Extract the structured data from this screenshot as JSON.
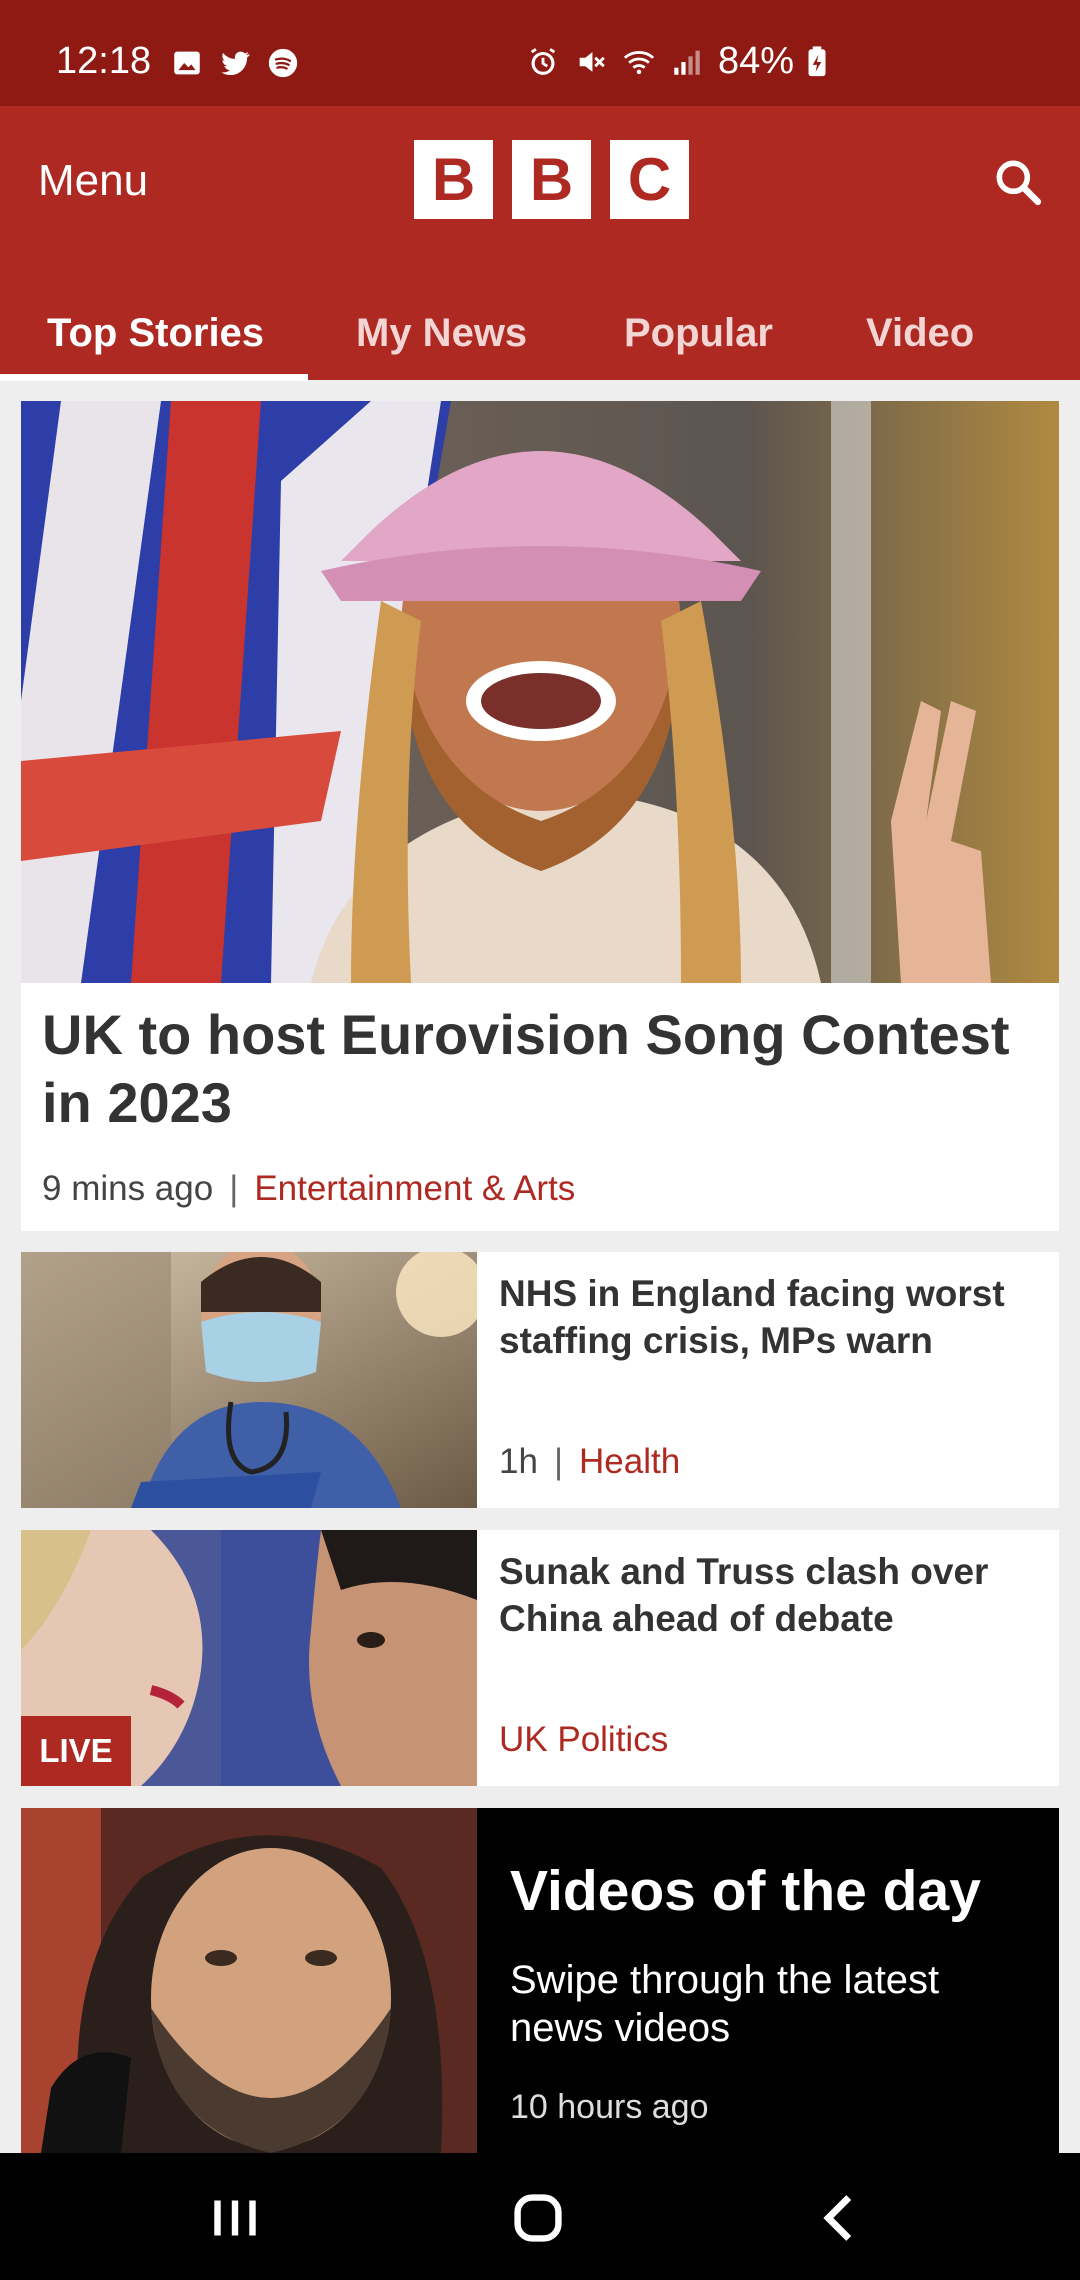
{
  "status_bar": {
    "time": "12:18",
    "battery": "84%",
    "left_icons": [
      "gallery-icon",
      "twitter-icon",
      "spotify-icon"
    ],
    "right_icons": [
      "alarm-icon",
      "mute-icon",
      "wifi-icon",
      "signal-icon",
      "battery-charging-icon"
    ]
  },
  "header": {
    "menu_label": "Menu",
    "logo": [
      "B",
      "B",
      "C"
    ],
    "search_icon": "search-icon",
    "brand_color": "#ad2921"
  },
  "tabs": [
    {
      "label": "Top Stories",
      "active": true
    },
    {
      "label": "My News",
      "active": false
    },
    {
      "label": "Popular",
      "active": false
    },
    {
      "label": "Video",
      "active": false
    }
  ],
  "stories": [
    {
      "title": "UK to host Eurovision Song Contest in 2023",
      "time": "9 mins ago",
      "category": "Entertainment & Arts"
    },
    {
      "title": "NHS in England facing worst staffing crisis, MPs warn",
      "time": "1h",
      "category": "Health"
    },
    {
      "title": "Sunak and Truss clash over China ahead of debate",
      "badge": "LIVE",
      "category": "UK Politics"
    }
  ],
  "videos_promo": {
    "title": "Videos of the day",
    "subtitle": "Swipe through the latest news videos",
    "time": "10 hours ago"
  },
  "nav_bar": {
    "buttons": [
      "recent-apps-icon",
      "home-icon",
      "back-icon"
    ]
  }
}
